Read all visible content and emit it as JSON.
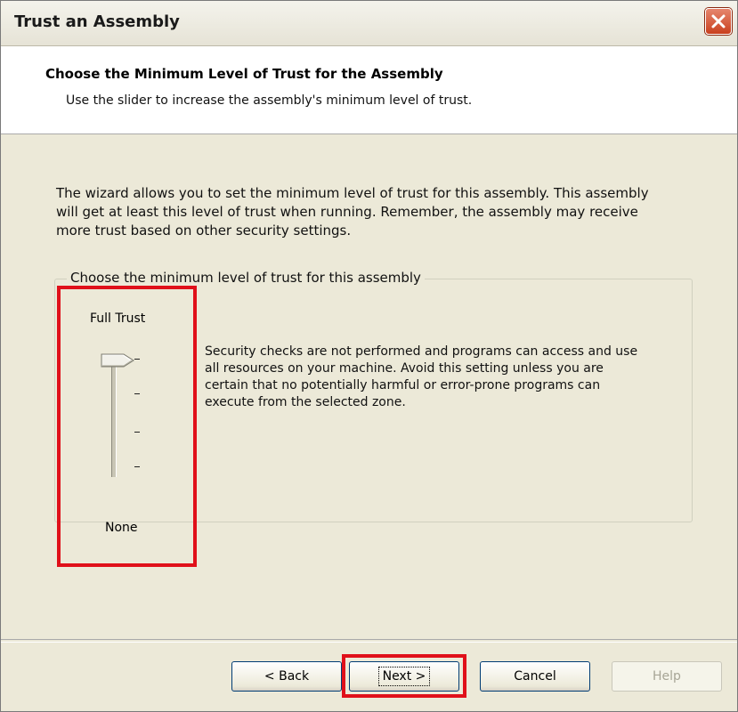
{
  "window": {
    "title": "Trust an Assembly"
  },
  "header": {
    "title": "Choose the Minimum Level of Trust for the Assembly",
    "subtitle": "Use the slider to increase the assembly's minimum level of trust."
  },
  "content": {
    "description": "The wizard allows you to set the minimum level of trust for this assembly.  This assembly will get at least this level of trust when running.  Remember, the assembly may receive more trust based on other security settings.",
    "group_label": "Choose the minimum level of trust for this assembly",
    "slider": {
      "top_label": "Full Trust",
      "bottom_label": "None",
      "levels": 4,
      "selected_level": 4,
      "selected_description": "Security checks are not performed and programs can access and use all resources on your machine.  Avoid this setting unless you are certain that no potentially harmful or error-prone programs can execute from the selected zone."
    }
  },
  "buttons": {
    "back": "< Back",
    "next": "Next >",
    "cancel": "Cancel",
    "help": "Help"
  },
  "colors": {
    "highlight": "#e0101a",
    "dialog_bg": "#ece9d8"
  },
  "icons": {
    "close": "close-icon",
    "slider_thumb": "slider-thumb-icon"
  }
}
